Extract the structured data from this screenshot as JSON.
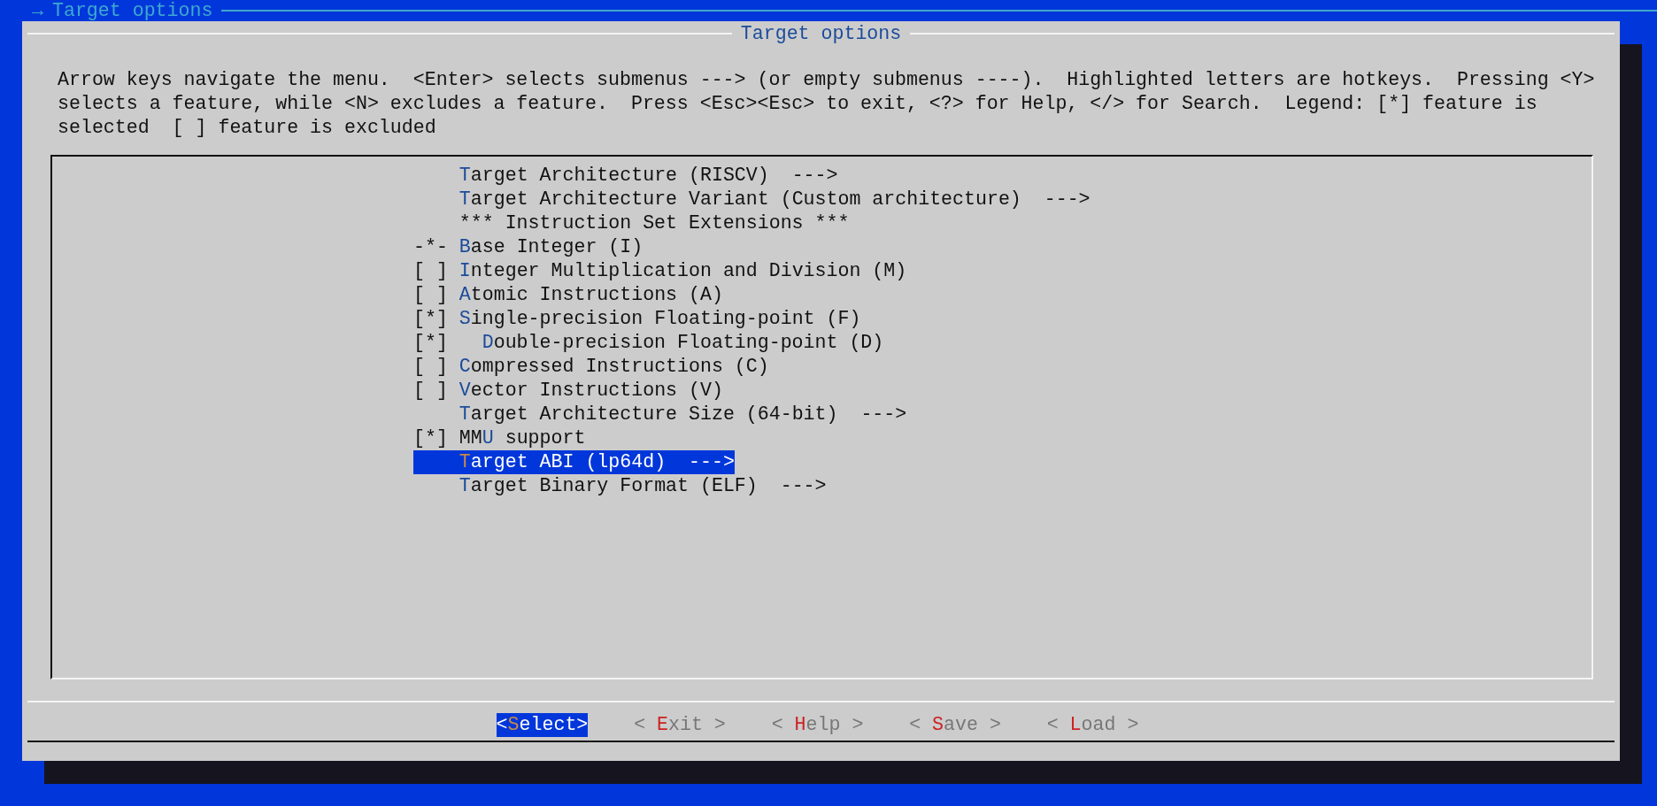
{
  "header": {
    "arrow": "→",
    "title": "Target options"
  },
  "dialog": {
    "title": "Target options",
    "help": "Arrow keys navigate the menu.  <Enter> selects submenus ---> (or empty submenus ----).  Highlighted letters are hotkeys.  Pressing <Y> selects a feature, while <N> excludes a feature.  Press <Esc><Esc> to exit, <?> for Help, </> for Search.  Legend: [*] feature is selected  [ ] feature is excluded",
    "items": [
      {
        "kind": "menu",
        "text": "**T**arget Architecture (RISCV)  --->",
        "selected": false
      },
      {
        "kind": "menu",
        "text": "**T**arget Architecture Variant (Custom architecture)  --->",
        "selected": false
      },
      {
        "kind": "comment",
        "text": "*** Instruction Set Extensions ***",
        "selected": false
      },
      {
        "kind": "option",
        "box": "-*-",
        "text": "**B**ase Integer (I)",
        "selected": false
      },
      {
        "kind": "option",
        "box": "[ ]",
        "text": "**I**nteger Multiplication and Division (M)",
        "selected": false
      },
      {
        "kind": "option",
        "box": "[ ]",
        "text": "**A**tomic Instructions (A)",
        "selected": false
      },
      {
        "kind": "option",
        "box": "[*]",
        "text": "**S**ingle-precision Floating-point (F)",
        "selected": false,
        "children": [
          {
            "kind": "option",
            "box": "[*]",
            "text": "**D**ouble-precision Floating-point (D)",
            "selected": false
          }
        ]
      },
      {
        "kind": "option",
        "box": "[ ]",
        "text": "**C**ompressed Instructions (C)",
        "selected": false
      },
      {
        "kind": "option",
        "box": "[ ]",
        "text": "**V**ector Instructions (V)",
        "selected": false
      },
      {
        "kind": "menu",
        "text": "**T**arget Architecture Size (64-bit)  --->",
        "selected": false
      },
      {
        "kind": "option",
        "box": "[*]",
        "text": "MM**U** support",
        "selected": false
      },
      {
        "kind": "menu",
        "text": "**T**arget ABI (lp64d)  --->",
        "selected": true
      },
      {
        "kind": "menu",
        "text": "**T**arget Binary Format (ELF)  --->",
        "selected": false
      }
    ],
    "buttons": [
      {
        "label": "<**S**elect>",
        "selected": true
      },
      {
        "label": "< **E**xit >",
        "selected": false
      },
      {
        "label": "< **H**elp >",
        "selected": false
      },
      {
        "label": "< **S**ave >",
        "selected": false
      },
      {
        "label": "< **L**oad >",
        "selected": false
      }
    ]
  }
}
